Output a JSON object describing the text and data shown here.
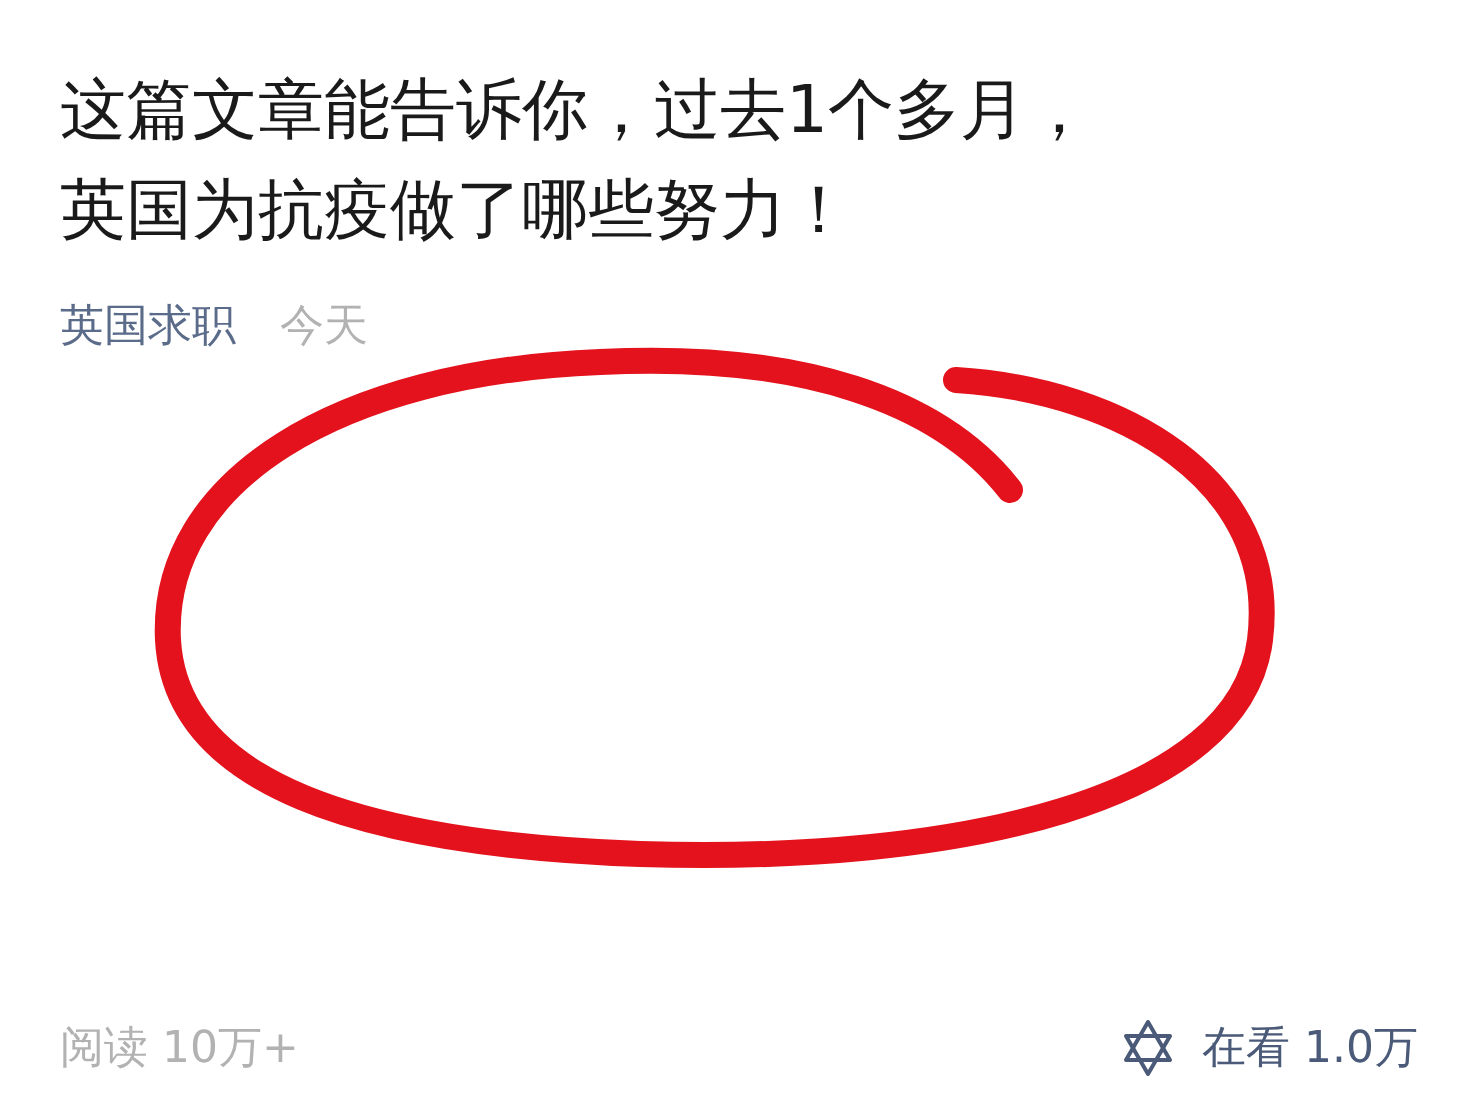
{
  "article": {
    "title_lines": [
      "这篇文章能告诉你，过去1个多月，",
      "英国为抗疫做了哪些努力！"
    ],
    "source": "英国求职",
    "time": "今天"
  },
  "footer": {
    "reads": "阅读 10万+",
    "watching": "在看 1.0万"
  }
}
